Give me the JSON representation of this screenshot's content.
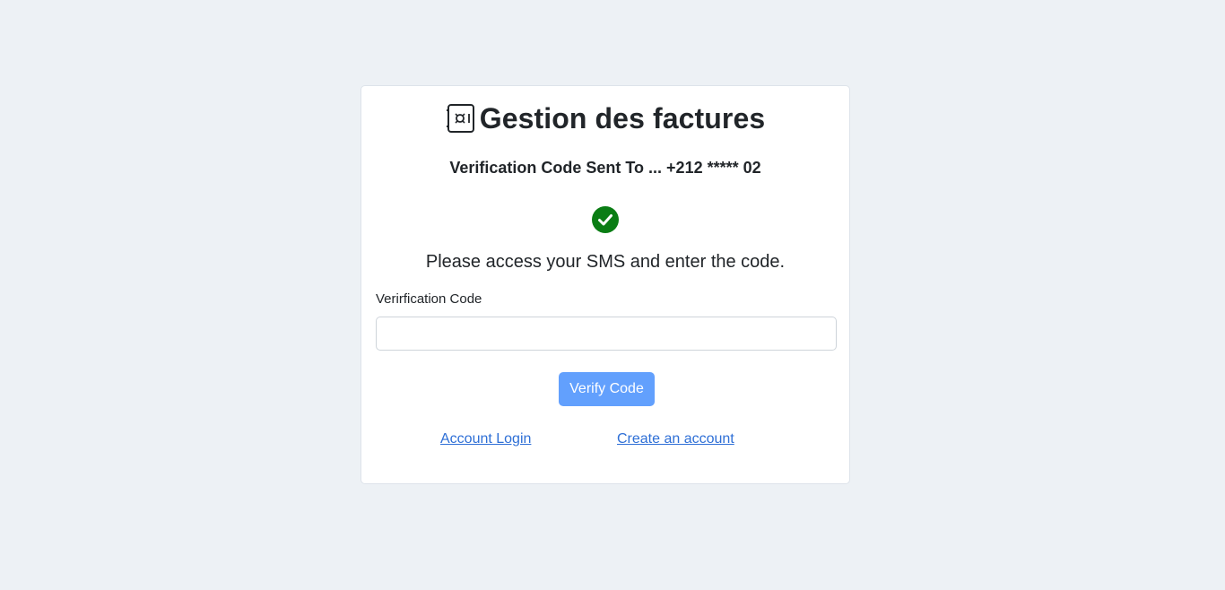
{
  "app": {
    "title": "Gestion des factures"
  },
  "verification": {
    "subtitle": "Verification Code Sent To ... +212 ***** 02",
    "instruction": "Please access your SMS and enter the code.",
    "field_label": "Verirfication Code",
    "field_value": "",
    "field_placeholder": "",
    "submit_label": "Verify Code"
  },
  "links": {
    "login": "Account Login",
    "create": "Create an account"
  },
  "icons": {
    "brand": "safe-icon",
    "status": "check-circle-icon"
  },
  "colors": {
    "background": "#edf1f5",
    "success": "#0a7d14",
    "button": "#62a0fd",
    "link": "#2e6fd6"
  }
}
